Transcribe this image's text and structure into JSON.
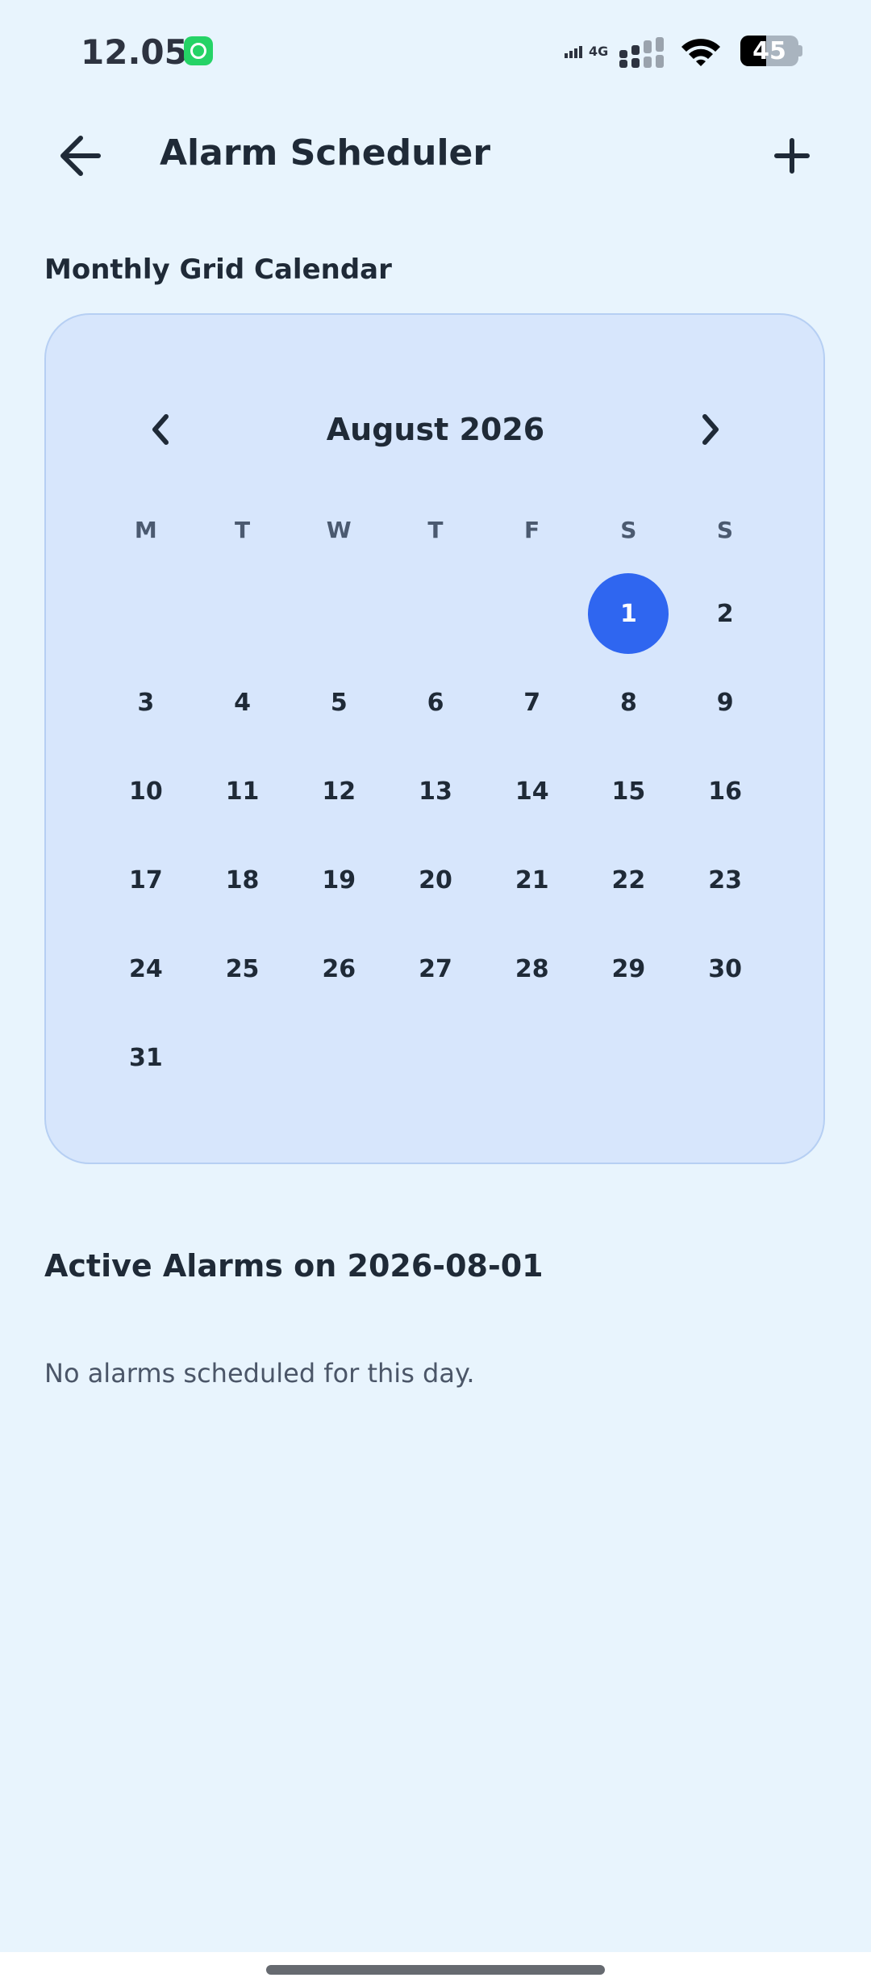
{
  "status_bar": {
    "time": "12.05",
    "network": "4G",
    "battery": "45"
  },
  "app_bar": {
    "title": "Alarm Scheduler",
    "back_icon": "arrow-left-icon",
    "add_icon": "plus-icon"
  },
  "calendar_section": {
    "title": "Monthly Grid Calendar"
  },
  "calendar": {
    "month_label": "August 2026",
    "prev_icon": "chevron-left-icon",
    "next_icon": "chevron-right-icon",
    "weekdays": [
      "M",
      "T",
      "W",
      "T",
      "F",
      "S",
      "S"
    ],
    "first_weekday_index": 5,
    "days_in_month": 31,
    "selected_day": 1,
    "days": [
      "1",
      "2",
      "3",
      "4",
      "5",
      "6",
      "7",
      "8",
      "9",
      "10",
      "11",
      "12",
      "13",
      "14",
      "15",
      "16",
      "17",
      "18",
      "19",
      "20",
      "21",
      "22",
      "23",
      "24",
      "25",
      "26",
      "27",
      "28",
      "29",
      "30",
      "31"
    ],
    "accent_color": "#2f66f0"
  },
  "alarms": {
    "title": "Active Alarms on 2026-08-01",
    "empty_message": "No alarms scheduled for this day."
  }
}
